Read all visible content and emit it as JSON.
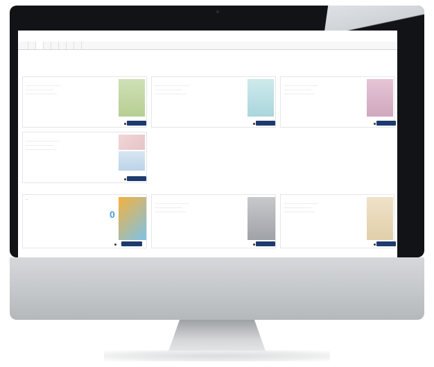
{
  "tabs": [
    "",
    "",
    "",
    "",
    "",
    "",
    "",
    ""
  ],
  "intro": "",
  "section1": {
    "title": "",
    "subtitle": ""
  },
  "section2": {
    "title": ""
  },
  "featured": {
    "title": "...",
    "lines": [
      "",
      "",
      "",
      "",
      "",
      ""
    ],
    "price_big": "0",
    "button": ""
  },
  "colors": {
    "accent": "#d06a1c",
    "button": "#1e3a6e"
  }
}
